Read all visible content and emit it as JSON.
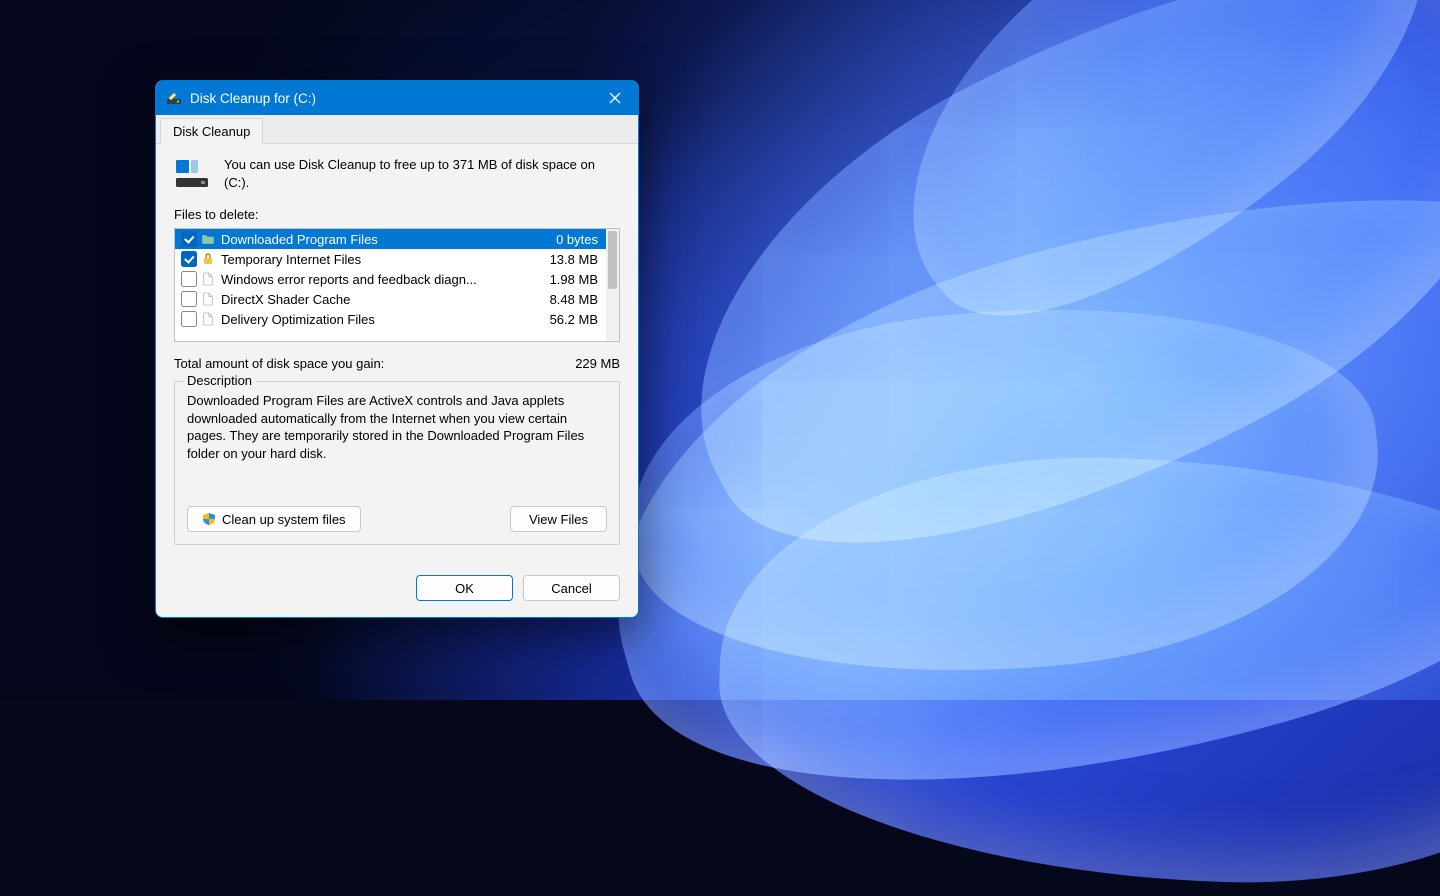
{
  "window": {
    "title": "Disk Cleanup for  (C:)"
  },
  "tab": {
    "label": "Disk Cleanup"
  },
  "intro": {
    "text": "You can use Disk Cleanup to free up to 371 MB of disk space on (C:)."
  },
  "list": {
    "caption": "Files to delete:",
    "items": [
      {
        "name": "Downloaded Program Files",
        "size": "0 bytes",
        "checked": true,
        "selected": true,
        "icon": "folder"
      },
      {
        "name": "Temporary Internet Files",
        "size": "13.8 MB",
        "checked": true,
        "selected": false,
        "icon": "lock"
      },
      {
        "name": "Windows error reports and feedback diagn...",
        "size": "1.98 MB",
        "checked": false,
        "selected": false,
        "icon": "file"
      },
      {
        "name": "DirectX Shader Cache",
        "size": "8.48 MB",
        "checked": false,
        "selected": false,
        "icon": "file"
      },
      {
        "name": "Delivery Optimization Files",
        "size": "56.2 MB",
        "checked": false,
        "selected": false,
        "icon": "file"
      }
    ]
  },
  "total": {
    "label": "Total amount of disk space you gain:",
    "value": "229 MB"
  },
  "description": {
    "legend": "Description",
    "text": "Downloaded Program Files are ActiveX controls and Java applets downloaded automatically from the Internet when you view certain pages. They are temporarily stored in the Downloaded Program Files folder on your hard disk."
  },
  "buttons": {
    "clean_system": "Clean up system files",
    "view_files": "View Files",
    "ok": "OK",
    "cancel": "Cancel"
  }
}
